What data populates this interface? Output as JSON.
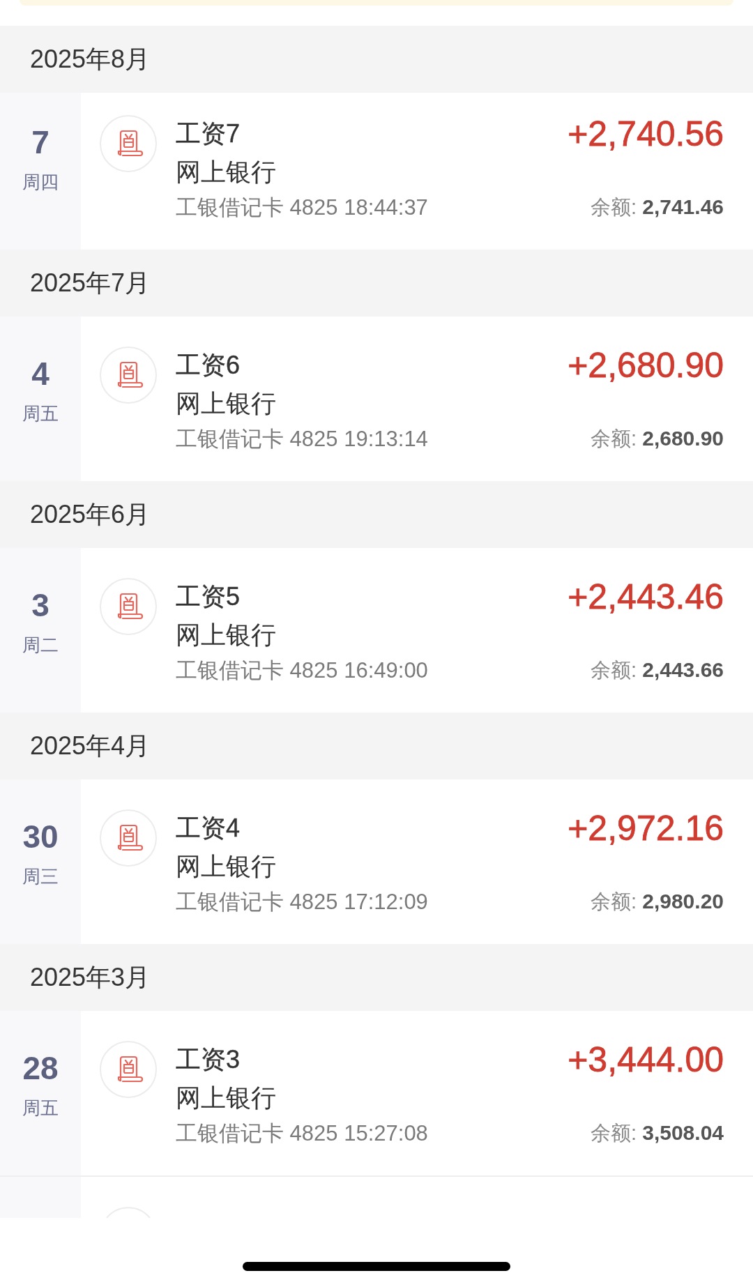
{
  "sections": [
    {
      "month": "2025年8月",
      "transactions": [
        {
          "day": "7",
          "weekday": "周四",
          "title": "工资7",
          "channel": "网上银行",
          "account": "工银借记卡 4825 18:44:37",
          "amount": "+2,740.56",
          "balance": "余额: **2,741.46**"
        }
      ]
    },
    {
      "month": "2025年7月",
      "transactions": [
        {
          "day": "4",
          "weekday": "周五",
          "title": "工资6",
          "channel": "网上银行",
          "account": "工银借记卡 4825 19:13:14",
          "amount": "+2,680.90",
          "balance": "余额: **2,680.90**"
        }
      ]
    },
    {
      "month": "2025年6月",
      "transactions": [
        {
          "day": "3",
          "weekday": "周二",
          "title": "工资5",
          "channel": "网上银行",
          "account": "工银借记卡 4825 16:49:00",
          "amount": "+2,443.46",
          "balance": "余额: **2,443.66**"
        }
      ]
    },
    {
      "month": "2025年4月",
      "transactions": [
        {
          "day": "30",
          "weekday": "周三",
          "title": "工资4",
          "channel": "网上银行",
          "account": "工银借记卡 4825 17:12:09",
          "amount": "+2,972.16",
          "balance": "余额: **2,980.20**"
        }
      ]
    },
    {
      "month": "2025年3月",
      "transactions": [
        {
          "day": "28",
          "weekday": "周五",
          "title": "工资3",
          "channel": "网上银行",
          "account": "工银借记卡 4825 15:27:08",
          "amount": "+3,444.00",
          "balance": "余额: **3,508.04**"
        }
      ]
    }
  ]
}
